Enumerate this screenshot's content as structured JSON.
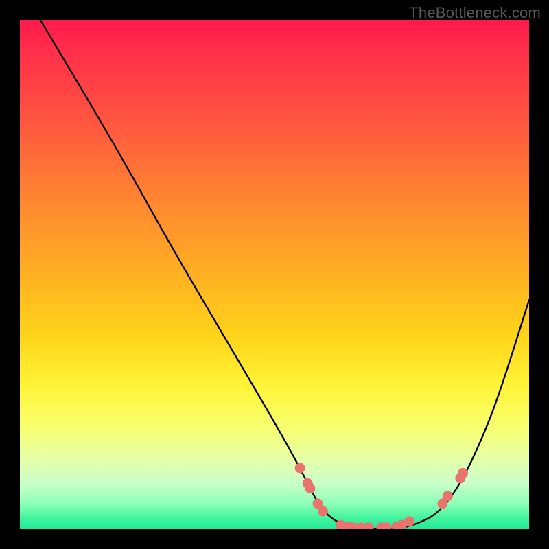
{
  "watermark": "TheBottleneck.com",
  "chart_data": {
    "type": "line",
    "title": "",
    "xlabel": "",
    "ylabel": "",
    "xlim": [
      0,
      100
    ],
    "ylim": [
      0,
      100
    ],
    "series": [
      {
        "name": "curve",
        "x": [
          4,
          10,
          20,
          30,
          40,
          50,
          55,
          58,
          60,
          63,
          66,
          70,
          74,
          78,
          82,
          86,
          90,
          94,
          100
        ],
        "y": [
          100,
          90,
          73,
          55,
          38,
          21,
          12,
          6,
          3,
          1,
          0,
          0,
          0,
          1,
          3,
          8,
          16,
          26,
          45
        ]
      }
    ],
    "scatter_points": {
      "name": "markers",
      "color": "#e8746d",
      "points": [
        {
          "x": 55.0,
          "y": 12.0
        },
        {
          "x": 56.5,
          "y": 9.0
        },
        {
          "x": 57.0,
          "y": 8.0
        },
        {
          "x": 58.5,
          "y": 5.0
        },
        {
          "x": 59.5,
          "y": 3.5
        },
        {
          "x": 63.0,
          "y": 0.8
        },
        {
          "x": 64.5,
          "y": 0.5
        },
        {
          "x": 65.5,
          "y": 0.3
        },
        {
          "x": 67.0,
          "y": 0.3
        },
        {
          "x": 68.5,
          "y": 0.3
        },
        {
          "x": 71.0,
          "y": 0.3
        },
        {
          "x": 72.0,
          "y": 0.3
        },
        {
          "x": 74.0,
          "y": 0.5
        },
        {
          "x": 75.0,
          "y": 0.8
        },
        {
          "x": 76.5,
          "y": 1.5
        },
        {
          "x": 83.0,
          "y": 5.0
        },
        {
          "x": 84.0,
          "y": 6.5
        },
        {
          "x": 86.5,
          "y": 10.0
        },
        {
          "x": 87.0,
          "y": 11.0
        }
      ]
    },
    "gradient_stops": [
      {
        "pos": 0,
        "color": "#ff1a4d"
      },
      {
        "pos": 20,
        "color": "#ff5640"
      },
      {
        "pos": 48,
        "color": "#ffaa24"
      },
      {
        "pos": 72,
        "color": "#fff438"
      },
      {
        "pos": 91,
        "color": "#c9ffc9"
      },
      {
        "pos": 100,
        "color": "#22e997"
      }
    ]
  }
}
